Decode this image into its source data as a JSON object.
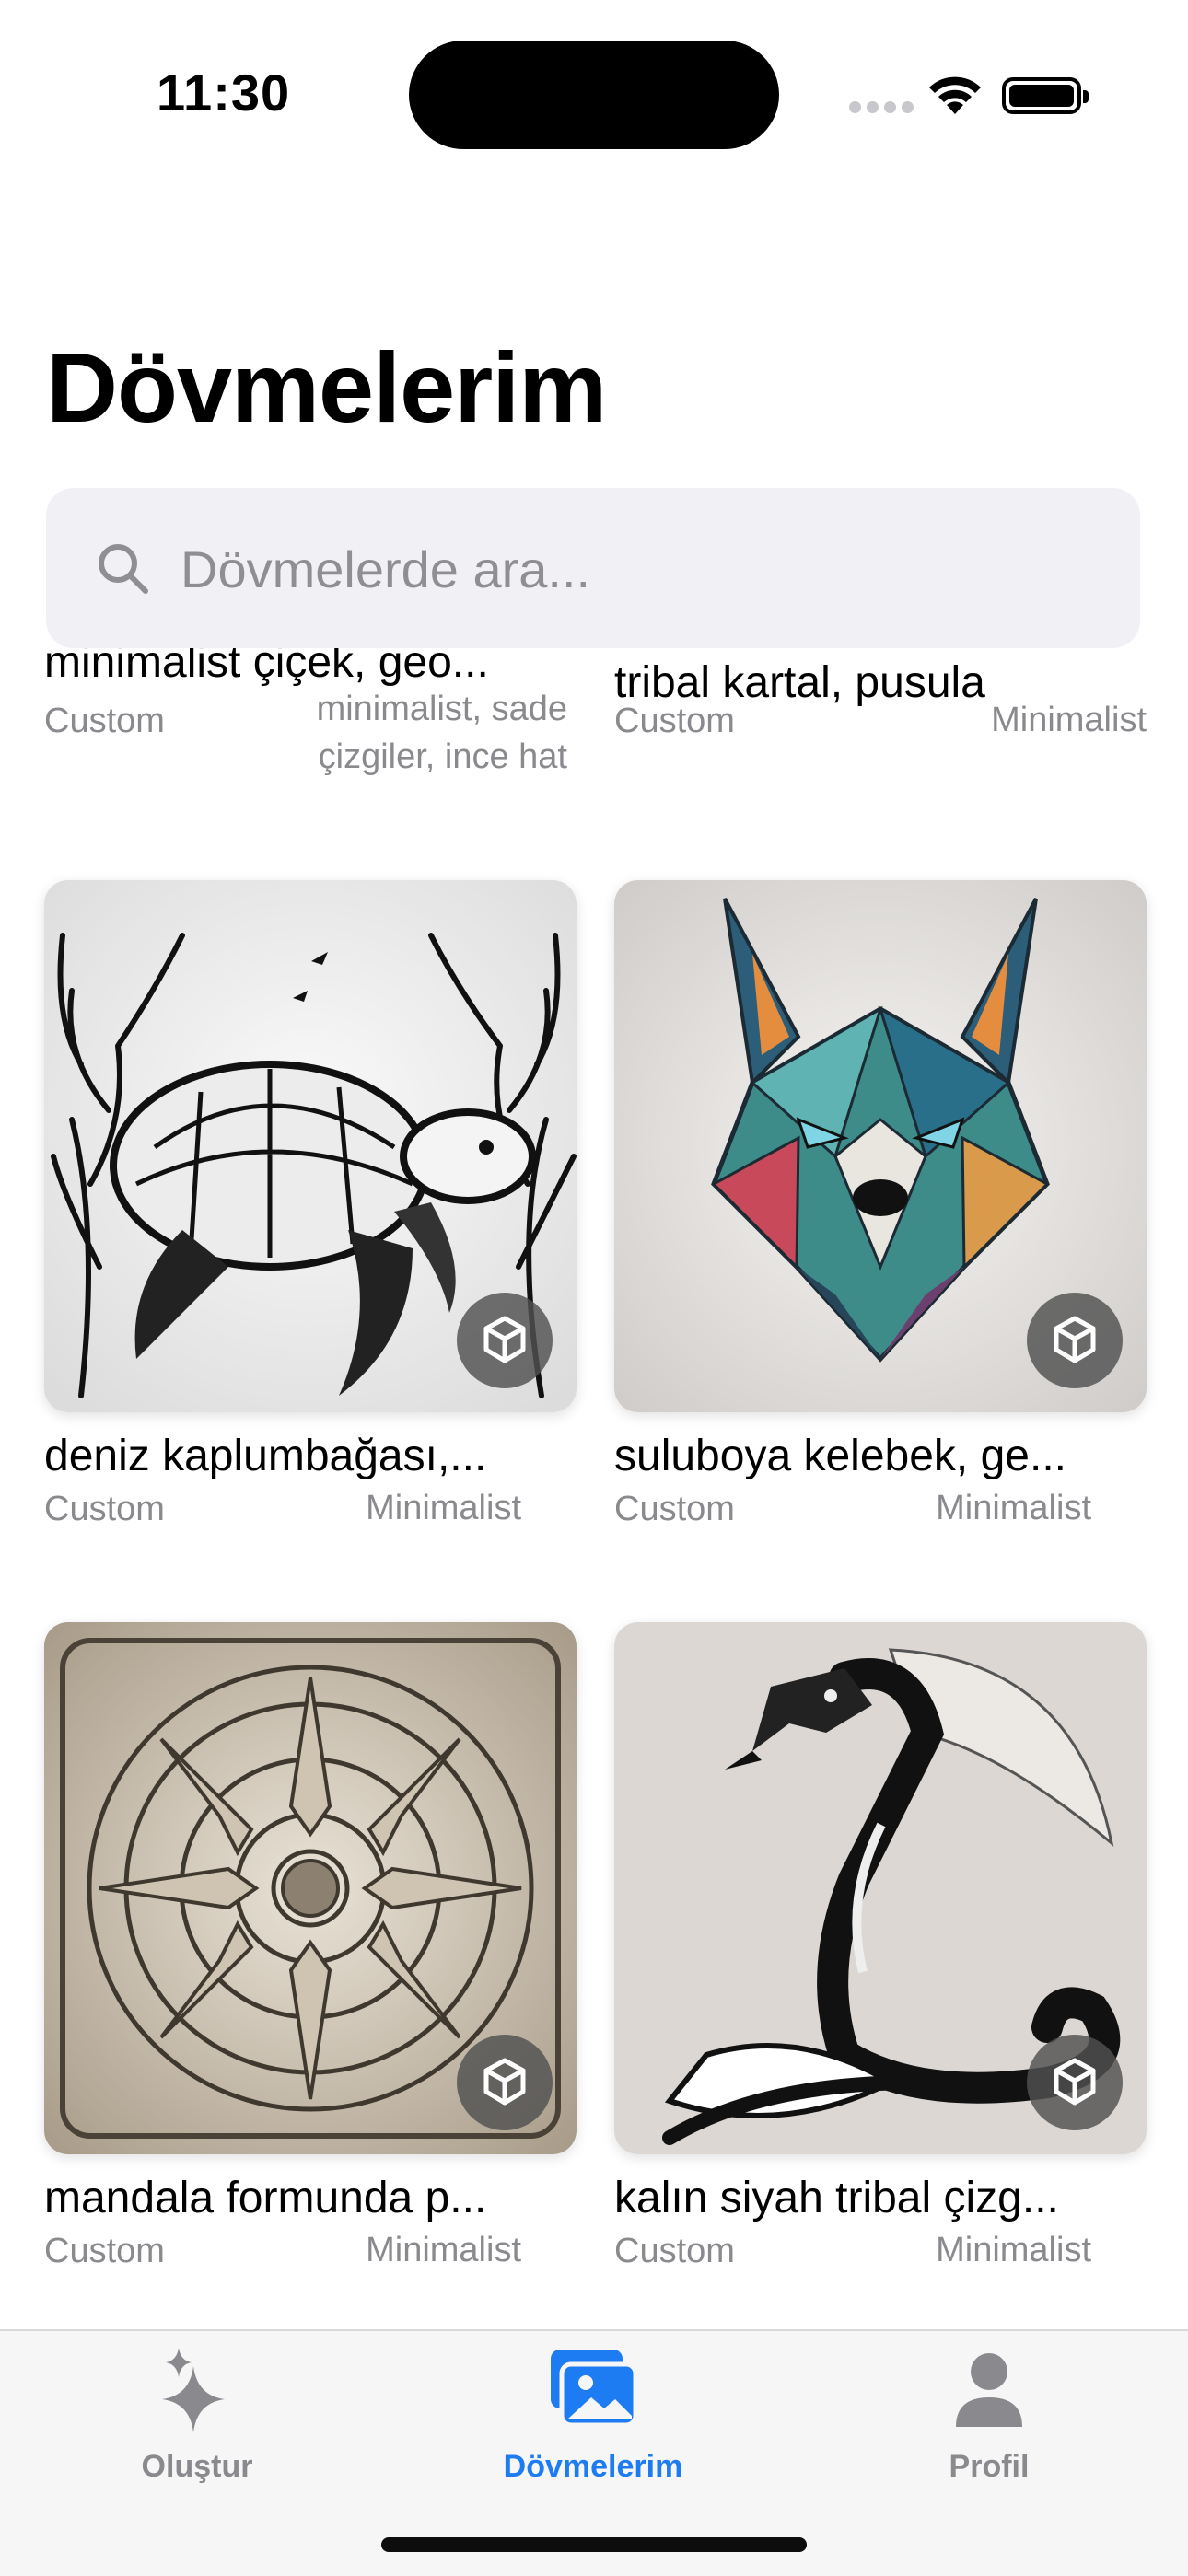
{
  "status": {
    "time": "11:30"
  },
  "page": {
    "title": "Dövmelerim"
  },
  "search": {
    "placeholder": "Dövmelerde ara..."
  },
  "cards": [
    {
      "title": "minimalist çiçek, geo...",
      "category": "Custom",
      "style": "minimalist, sade çizgiler, ince hat",
      "image": "partial"
    },
    {
      "title": "tribal kartal, pusula",
      "category": "Custom",
      "style": "Minimalist",
      "image": "partial"
    },
    {
      "title": "deniz kaplumbağası,...",
      "category": "Custom",
      "style": "Minimalist",
      "image": "turtle-tattoo"
    },
    {
      "title": "suluboya kelebek, ge...",
      "category": "Custom",
      "style": "Minimalist",
      "image": "geometric-wolf-tattoo"
    },
    {
      "title": "mandala formunda p...",
      "category": "Custom",
      "style": "Minimalist",
      "image": "mandala-tattoo"
    },
    {
      "title": "kalın siyah tribal çizg...",
      "category": "Custom",
      "style": "Minimalist",
      "image": "dragon-tattoo"
    }
  ],
  "tabs": [
    {
      "label": "Oluştur",
      "icon": "sparkles-icon",
      "active": false
    },
    {
      "label": "Dövmelerim",
      "icon": "photos-icon",
      "active": true
    },
    {
      "label": "Profil",
      "icon": "person-icon",
      "active": false
    }
  ],
  "colors": {
    "accent": "#1d7cf2",
    "secondary_text": "#8a8a8e",
    "search_bg": "#f0f0f5"
  }
}
